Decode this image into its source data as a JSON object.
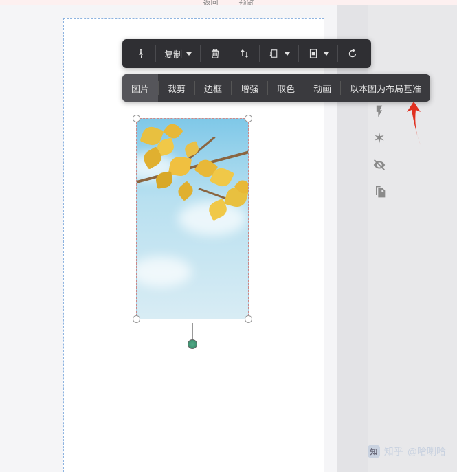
{
  "top_nav": {
    "back": "返回",
    "preview": "预览"
  },
  "toolbar_primary": {
    "pin": "pin-icon",
    "copy_label": "复制",
    "delete": "trash-icon",
    "flip": "flip-icon",
    "align_left": "align-icon",
    "align_center": "align-center-icon",
    "rotate": "rotate-icon"
  },
  "toolbar_secondary": {
    "tabs": [
      {
        "label": "图片",
        "active": true
      },
      {
        "label": "裁剪",
        "active": false
      },
      {
        "label": "边框",
        "active": false
      },
      {
        "label": "增强",
        "active": false
      },
      {
        "label": "取色",
        "active": false
      },
      {
        "label": "动画",
        "active": false
      },
      {
        "label": "以本图为布局基准",
        "active": false
      }
    ]
  },
  "sidebar": {
    "icons": [
      "lightning-icon",
      "asterisk-icon",
      "visibility-off-icon",
      "copy-files-icon"
    ]
  },
  "selected_image": {
    "description": "ginkgo-leaves-sky",
    "handles": [
      "tl",
      "tr",
      "bl",
      "br"
    ],
    "rotate_handle": true
  },
  "watermark": {
    "platform": "知乎",
    "author": "@哈喇哈"
  }
}
